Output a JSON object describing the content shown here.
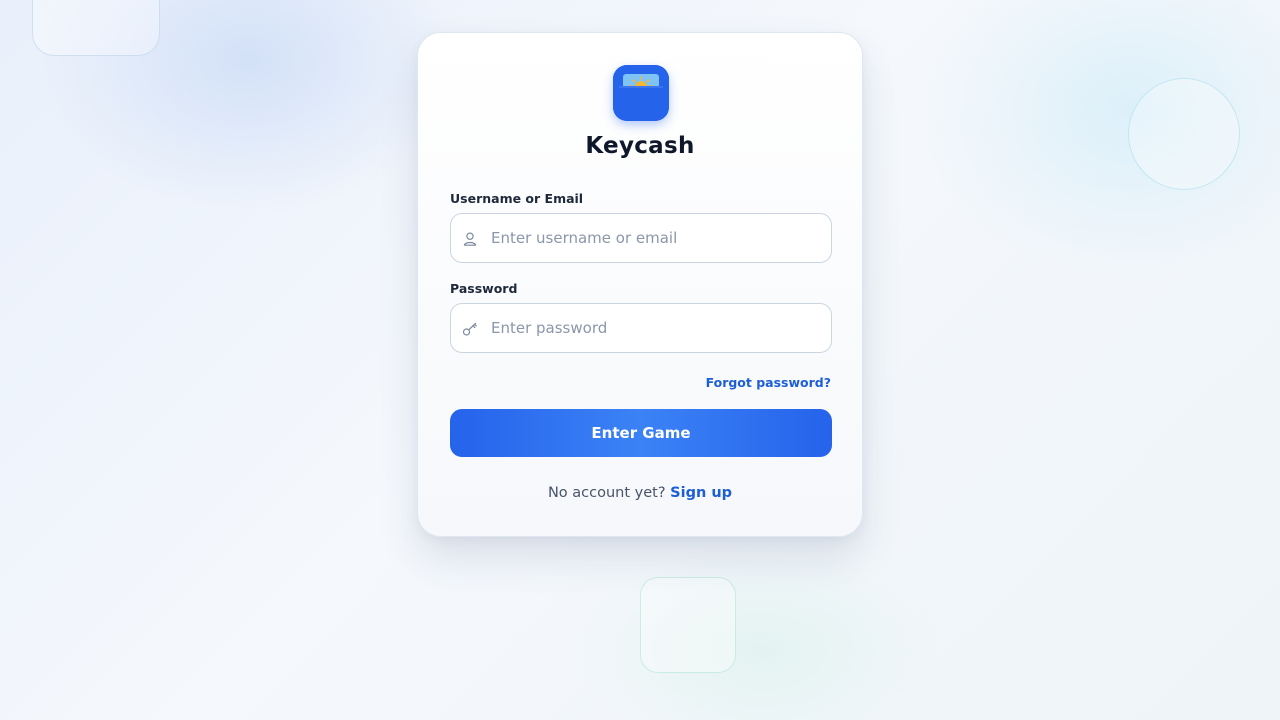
{
  "app": {
    "title": "Keycash"
  },
  "form": {
    "username_label": "Username or Email",
    "username_placeholder": "Enter username or email",
    "username_value": "",
    "password_label": "Password",
    "password_placeholder": "Enter password",
    "password_value": "",
    "forgot_link": "Forgot password?",
    "submit_label": "Enter Game"
  },
  "footer": {
    "prompt": "No account yet?",
    "signup_link": "Sign up"
  },
  "icons": {
    "logo": "wallet-sun-logo-icon",
    "username": "user-icon",
    "password": "key-icon"
  },
  "colors": {
    "accent": "#2563eb",
    "link": "#1d5fd6",
    "title": "#0f172a",
    "muted_text": "#475569"
  }
}
